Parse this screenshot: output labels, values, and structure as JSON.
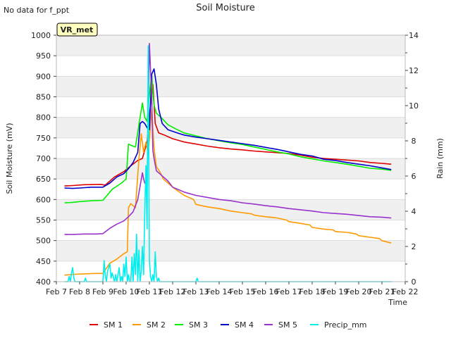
{
  "chart_data": {
    "type": "line",
    "title": "Soil Moisture",
    "no_data_note": "No data for f_ppt",
    "badge": "VR_met",
    "xlabel": "Time",
    "ylabel_left": "Soil Moisture (mV)",
    "ylabel_right": "Rain (mm)",
    "x_ticks": [
      "Feb 7",
      "Feb 8",
      "Feb 9",
      "Feb 10",
      "Feb 11",
      "Feb 12",
      "Feb 13",
      "Feb 14",
      "Feb 15",
      "Feb 16",
      "Feb 17",
      "Feb 18",
      "Feb 19",
      "Feb 20",
      "Feb 21",
      "Feb 22"
    ],
    "xlim": [
      7,
      22
    ],
    "ylim_left": [
      400,
      1000
    ],
    "y_ticks_left": [
      "400",
      "450",
      "500",
      "550",
      "600",
      "650",
      "700",
      "750",
      "800",
      "850",
      "900",
      "950",
      "1000"
    ],
    "ylim_right": [
      0,
      14
    ],
    "y_ticks_right": [
      "0",
      "2",
      "4",
      "6",
      "8",
      "10",
      "12",
      "14"
    ],
    "grid": "horizontal bands",
    "legend_position": "bottom",
    "series": [
      {
        "name": "SM 1",
        "color": "#dd0000",
        "axis": "left",
        "x": [
          7.35,
          7.7,
          8.2,
          8.9,
          9.1,
          9.5,
          9.9,
          10.2,
          10.5,
          10.7,
          10.9,
          11.05,
          11.15,
          11.25,
          11.4,
          11.6,
          12.0,
          12.5,
          13.0,
          13.5,
          14.0,
          14.5,
          15.0,
          15.5,
          16.0,
          16.5,
          17.0,
          17.5,
          18.0,
          18.5,
          19.0,
          19.5,
          20.0,
          20.5,
          21.0,
          21.4
        ],
        "y": [
          633,
          634,
          636,
          637,
          635,
          655,
          668,
          682,
          695,
          700,
          740,
          835,
          880,
          785,
          762,
          758,
          748,
          740,
          735,
          730,
          726,
          723,
          721,
          718,
          716,
          714,
          712,
          708,
          703,
          700,
          698,
          696,
          694,
          690,
          688,
          686
        ]
      },
      {
        "name": "SM 2",
        "color": "#ff9900",
        "axis": "left",
        "x": [
          7.35,
          7.8,
          8.2,
          8.7,
          9.0,
          9.3,
          9.6,
          9.9,
          10.05,
          10.1,
          10.2,
          10.4,
          10.55,
          10.65,
          10.75,
          10.85,
          10.95,
          11.1,
          11.2,
          11.3,
          11.45,
          11.6,
          12.0,
          12.5,
          12.9,
          13.0,
          13.5,
          14.0,
          14.5,
          15.0,
          15.4,
          15.5,
          16.0,
          16.5,
          16.9,
          17.0,
          17.5,
          17.9,
          18.0,
          18.5,
          18.9,
          19.0,
          19.5,
          19.9,
          20.0,
          20.5,
          20.9,
          21.0,
          21.4
        ],
        "y": [
          416,
          418,
          419,
          420,
          420,
          445,
          455,
          468,
          473,
          580,
          590,
          580,
          700,
          760,
          715,
          740,
          710,
          820,
          725,
          680,
          668,
          650,
          630,
          610,
          600,
          588,
          582,
          578,
          572,
          568,
          565,
          562,
          558,
          555,
          550,
          546,
          542,
          538,
          532,
          528,
          526,
          522,
          520,
          516,
          512,
          508,
          505,
          500,
          494
        ]
      },
      {
        "name": "SM 3",
        "color": "#00ee00",
        "axis": "left",
        "x": [
          7.35,
          7.7,
          8.0,
          8.5,
          9.0,
          9.4,
          9.8,
          10.0,
          10.1,
          10.2,
          10.4,
          10.6,
          10.7,
          10.8,
          10.9,
          11.0,
          11.1,
          11.15,
          11.2,
          11.3,
          11.5,
          11.8,
          12.2,
          12.5,
          13.0,
          13.5,
          14.0,
          14.5,
          15.0,
          15.5,
          16.0,
          16.5,
          17.0,
          17.5,
          18.0,
          18.5,
          19.0,
          19.5,
          20.0,
          20.5,
          21.0,
          21.4
        ],
        "y": [
          592,
          593,
          595,
          597,
          598,
          625,
          640,
          650,
          735,
          732,
          728,
          800,
          835,
          800,
          790,
          855,
          905,
          860,
          830,
          810,
          800,
          782,
          770,
          762,
          755,
          748,
          743,
          738,
          734,
          728,
          722,
          716,
          711,
          704,
          699,
          694,
          690,
          686,
          681,
          676,
          674,
          671
        ]
      },
      {
        "name": "SM 4",
        "color": "#0000cc",
        "axis": "left",
        "x": [
          7.35,
          7.7,
          8.0,
          8.5,
          9.0,
          9.3,
          9.6,
          9.9,
          10.1,
          10.3,
          10.5,
          10.6,
          10.7,
          10.8,
          10.9,
          11.0,
          11.1,
          11.2,
          11.3,
          11.4,
          11.55,
          11.8,
          12.2,
          12.5,
          13.0,
          13.5,
          14.0,
          14.5,
          15.0,
          15.5,
          16.0,
          16.5,
          17.0,
          17.5,
          18.0,
          18.5,
          19.0,
          19.5,
          20.0,
          20.5,
          21.0,
          21.4
        ],
        "y": [
          628,
          627,
          628,
          630,
          630,
          640,
          655,
          663,
          675,
          690,
          715,
          785,
          790,
          785,
          775,
          770,
          905,
          918,
          880,
          820,
          785,
          770,
          762,
          757,
          752,
          748,
          744,
          740,
          736,
          732,
          727,
          722,
          716,
          710,
          706,
          698,
          695,
          690,
          686,
          682,
          677,
          673
        ]
      },
      {
        "name": "SM 5",
        "color": "#9933cc",
        "axis": "left",
        "x": [
          7.35,
          7.7,
          8.2,
          8.7,
          9.0,
          9.3,
          9.6,
          9.9,
          10.1,
          10.3,
          10.5,
          10.7,
          10.75,
          10.8,
          10.9,
          11.0,
          11.1,
          11.15,
          11.2,
          11.3,
          11.5,
          11.8,
          12.0,
          12.5,
          13.0,
          13.5,
          14.0,
          14.5,
          15.0,
          15.5,
          16.0,
          16.5,
          17.0,
          17.5,
          18.0,
          18.5,
          19.0,
          19.5,
          20.0,
          20.5,
          21.0,
          21.4
        ],
        "y": [
          515,
          515,
          516,
          516,
          517,
          530,
          540,
          548,
          558,
          570,
          600,
          665,
          650,
          640,
          635,
          980,
          850,
          720,
          700,
          670,
          660,
          645,
          630,
          618,
          610,
          605,
          600,
          597,
          592,
          589,
          585,
          582,
          578,
          575,
          572,
          568,
          566,
          564,
          561,
          558,
          557,
          555
        ]
      },
      {
        "name": "Precip_mm",
        "color": "#00eeee",
        "axis": "right",
        "x": [
          7.35,
          7.5,
          7.55,
          7.6,
          7.65,
          7.7,
          7.75,
          7.8,
          8.2,
          8.25,
          8.3,
          9.0,
          9.05,
          9.1,
          9.15,
          9.2,
          9.3,
          9.35,
          9.4,
          9.5,
          9.55,
          9.6,
          9.7,
          9.75,
          9.8,
          9.85,
          9.9,
          9.95,
          10.0,
          10.05,
          10.1,
          10.15,
          10.2,
          10.25,
          10.3,
          10.35,
          10.4,
          10.45,
          10.5,
          10.55,
          10.6,
          10.65,
          10.7,
          10.75,
          10.8,
          10.85,
          10.9,
          10.95,
          11.0,
          11.05,
          11.1,
          11.15,
          11.2,
          11.25,
          11.3,
          11.35,
          11.4,
          11.45,
          11.5,
          11.55,
          11.6,
          11.65,
          13.0,
          13.05,
          13.1,
          21.4
        ],
        "y": [
          0,
          0,
          0.3,
          0,
          0.5,
          0.8,
          0.2,
          0,
          0,
          0.2,
          0,
          0,
          1.2,
          0.4,
          0,
          0.6,
          1.0,
          0.2,
          0.5,
          0,
          0.4,
          0,
          0.8,
          0,
          0.3,
          0,
          1.0,
          0.3,
          1.4,
          0,
          0.4,
          0,
          0,
          1.4,
          0,
          1.6,
          0.4,
          2.7,
          0,
          1.8,
          0,
          0.6,
          2.0,
          0.4,
          4.0,
          6.6,
          3.0,
          13.4,
          1.2,
          0.3,
          0,
          0.4,
          0,
          1.7,
          0.3,
          0,
          0.2,
          0,
          0,
          0,
          0,
          0,
          0,
          0.2,
          0,
          0
        ]
      }
    ]
  }
}
